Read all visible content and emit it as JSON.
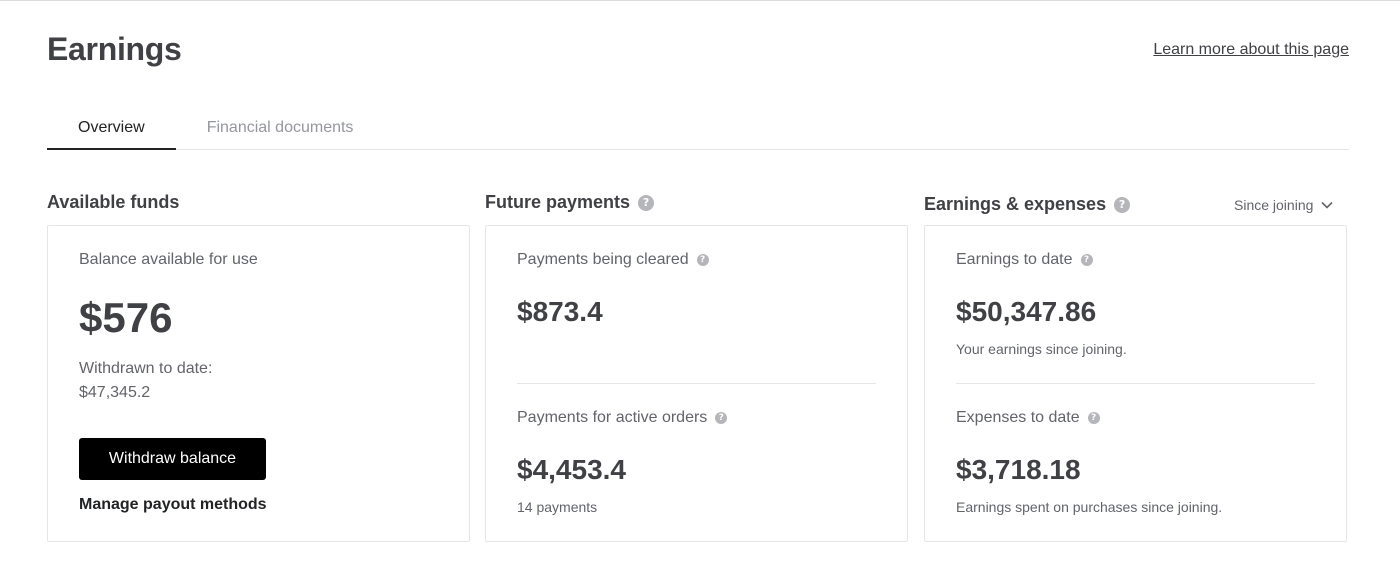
{
  "header": {
    "title": "Earnings",
    "learn_more": "Learn more about this page"
  },
  "tabs": [
    {
      "label": "Overview",
      "active": true
    },
    {
      "label": "Financial documents",
      "active": false
    }
  ],
  "available_funds": {
    "title": "Available funds",
    "balance_label": "Balance available for use",
    "balance_value": "$576",
    "withdrawn_label": "Withdrawn to date:",
    "withdrawn_value": "$47,345.2",
    "withdraw_button": "Withdraw balance",
    "manage_link": "Manage payout methods"
  },
  "future_payments": {
    "title": "Future payments",
    "cleared_label": "Payments being cleared",
    "cleared_value": "$873.4",
    "active_label": "Payments for active orders",
    "active_value": "$4,453.4",
    "active_count": "14 payments"
  },
  "earnings_expenses": {
    "title": "Earnings & expenses",
    "period": "Since joining",
    "earnings_label": "Earnings to date",
    "earnings_value": "$50,347.86",
    "earnings_note": "Your earnings since joining.",
    "expenses_label": "Expenses to date",
    "expenses_value": "$3,718.18",
    "expenses_note": "Earnings spent on purchases since joining."
  },
  "icons": {
    "help": "?"
  },
  "colors": {
    "text": "#404145",
    "muted": "#62646a",
    "button_bg": "#000000",
    "border": "#e4e5e7"
  }
}
